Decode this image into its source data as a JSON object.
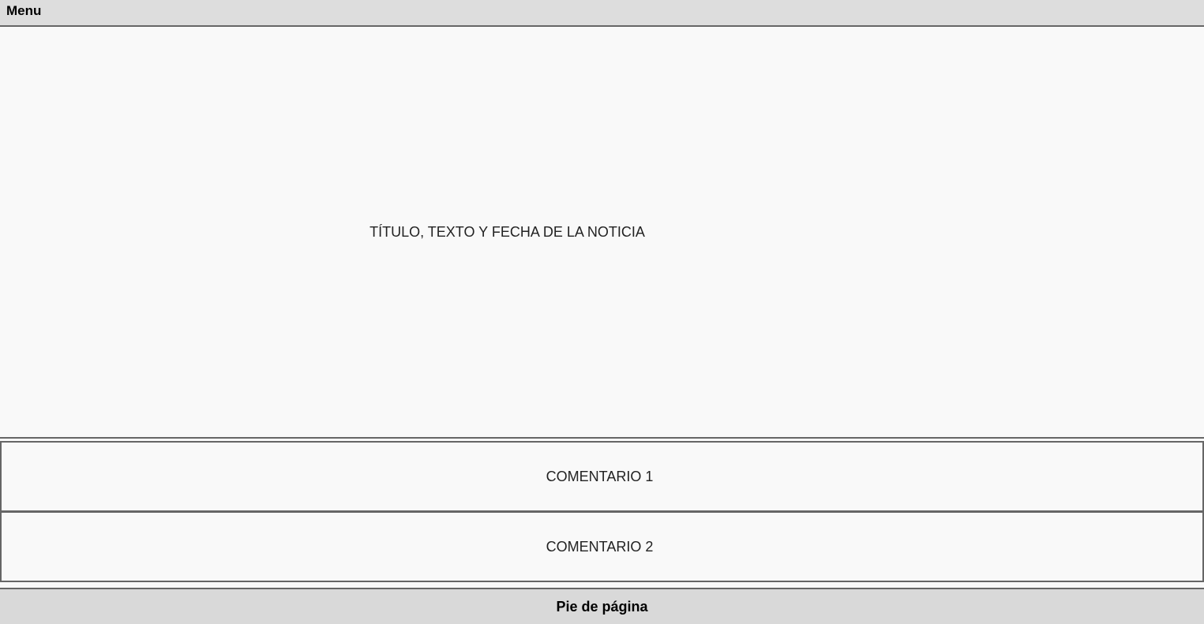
{
  "menu": {
    "label": "Menu"
  },
  "news": {
    "placeholder": "TÍTULO, TEXTO Y FECHA DE LA NOTICIA"
  },
  "comments": [
    {
      "label": "COMENTARIO 1"
    },
    {
      "label": "COMENTARIO 2"
    }
  ],
  "footer": {
    "label": "Pie de página"
  },
  "colors": {
    "background": "#f9f9f9",
    "bar_background": "#dddddd",
    "border": "#666666"
  }
}
